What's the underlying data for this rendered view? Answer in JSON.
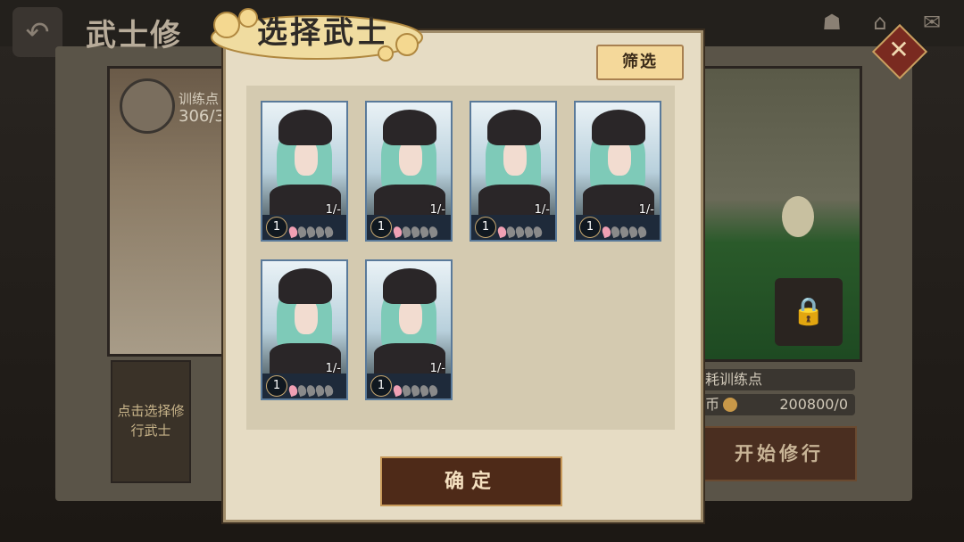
{
  "background": {
    "title": "武士修",
    "points_label": "训练点",
    "points_value": "306/3",
    "select_hint": "点击选择修行武士",
    "cost_label": "耗训练点",
    "coin_label": "币",
    "coin_value": "200800/0",
    "start_button": "开始修行",
    "back_icon": "back-arrow-icon",
    "close_icon": "close-icon"
  },
  "dialog": {
    "title": "选择武士",
    "filter_button": "筛选",
    "confirm_button": "确定",
    "cards": [
      {
        "level": "1",
        "count": "1/-",
        "stars_lit": 1,
        "stars_total": 5
      },
      {
        "level": "1",
        "count": "1/-",
        "stars_lit": 1,
        "stars_total": 5
      },
      {
        "level": "1",
        "count": "1/-",
        "stars_lit": 1,
        "stars_total": 5
      },
      {
        "level": "1",
        "count": "1/-",
        "stars_lit": 1,
        "stars_total": 5
      },
      {
        "level": "1",
        "count": "1/-",
        "stars_lit": 1,
        "stars_total": 5
      },
      {
        "level": "1",
        "count": "1/-",
        "stars_lit": 1,
        "stars_total": 5
      }
    ]
  },
  "colors": {
    "dialog_bg": "#e6dcc4",
    "card_border": "#5a7a9a",
    "petal_on": "#f0a0b4",
    "confirm_bg": "#4e2a18"
  }
}
